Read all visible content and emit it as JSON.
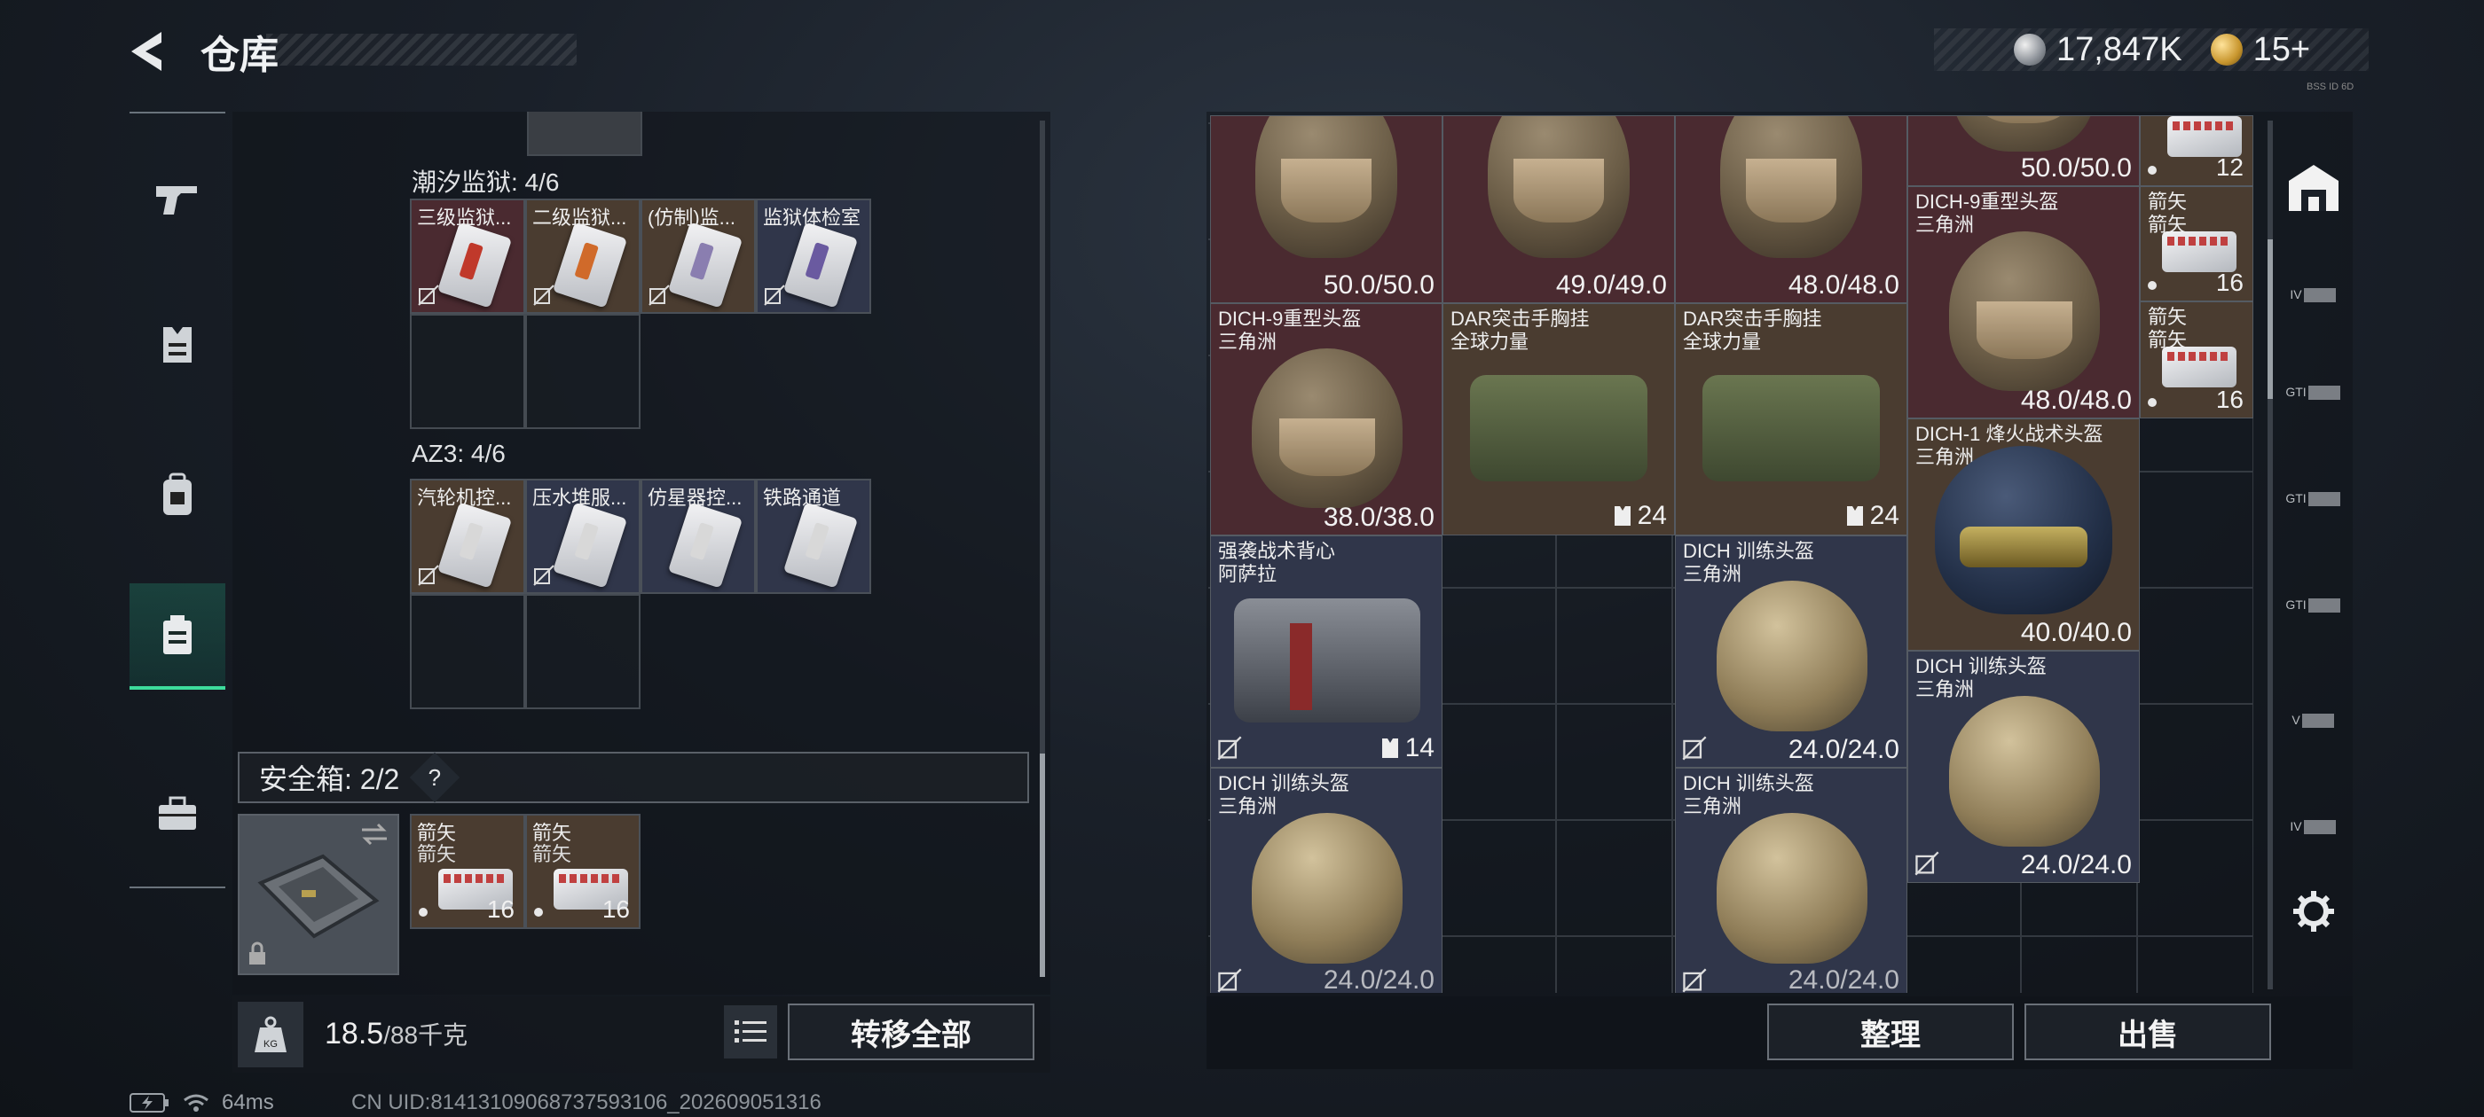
{
  "header": {
    "title": "仓库",
    "currency_silver": "17,847K",
    "currency_gold": "15+",
    "tiny_info": "BSS ID 6D"
  },
  "nav_left": [
    {
      "icon": "pistol-icon"
    },
    {
      "icon": "vest-icon"
    },
    {
      "icon": "backpack-icon"
    },
    {
      "icon": "storage-box-icon",
      "active": true
    },
    {
      "icon": "briefcase-icon"
    }
  ],
  "containers": [
    {
      "label": "潮汐监狱: 4/6",
      "items": [
        {
          "name": "三级监狱...",
          "color": "red",
          "kc": "#c0392b"
        },
        {
          "name": "二级监狱...",
          "color": "brown",
          "kc": "#d06a2a"
        },
        {
          "name": "(仿制)监...",
          "color": "brown",
          "kc": "#8a7eb0"
        },
        {
          "name": "监狱体检室",
          "color": "blue",
          "kc": "#6a5aa0"
        }
      ]
    },
    {
      "label": "AZ3: 4/6",
      "items": [
        {
          "name": "汽轮机控...",
          "color": "brown",
          "kc": "#d8d8d8"
        },
        {
          "name": "压水堆服...",
          "color": "blue",
          "kc": "#d8d8d8"
        },
        {
          "name": "仿星器控...",
          "color": "blue",
          "kc": "#d8d8d8"
        },
        {
          "name": "铁路通道",
          "color": "blue",
          "kc": "#d8d8d8"
        }
      ]
    }
  ],
  "safe_box": {
    "label": "安全箱: 2/2",
    "help": "?",
    "items": [
      {
        "name": "箭矢",
        "sub": "箭矢",
        "count": "16"
      },
      {
        "name": "箭矢",
        "sub": "箭矢",
        "count": "16"
      }
    ]
  },
  "weight": {
    "current": "18.5",
    "max": "/88千克"
  },
  "buttons": {
    "transfer_all": "转移全部",
    "sort": "整理",
    "sell": "出售"
  },
  "right_items": {
    "heavy1": {
      "dur": "50.0/50.0"
    },
    "heavy2": {
      "dur": "49.0/49.0"
    },
    "heavy3": {
      "dur": "48.0/48.0"
    },
    "top_partial": {
      "dur": "50.0/50.0"
    },
    "arrow_top": {
      "count": "12"
    },
    "heavy4": {
      "name": "DICH-9重型头盔",
      "sub": "三角洲",
      "dur": "48.0/48.0"
    },
    "arrow1": {
      "name": "箭矢",
      "sub": "箭矢",
      "count": "16"
    },
    "arrow2": {
      "name": "箭矢",
      "sub": "箭矢",
      "count": "16"
    },
    "heavy5": {
      "name": "DICH-9重型头盔",
      "sub": "三角洲",
      "dur": "38.0/38.0"
    },
    "dar1": {
      "name": "DAR突击手胸挂",
      "sub": "全球力量",
      "cap": "24"
    },
    "dar2": {
      "name": "DAR突击手胸挂",
      "sub": "全球力量",
      "cap": "24"
    },
    "night": {
      "name": "DICH-1 烽火战术头盔",
      "sub": "三角洲",
      "dur": "40.0/40.0"
    },
    "vest": {
      "name": "强袭战术背心",
      "sub": "阿萨拉",
      "cap": "14"
    },
    "train1": {
      "name": "DICH 训练头盔",
      "sub": "三角洲",
      "dur": "24.0/24.0"
    },
    "train2": {
      "name": "DICH 训练头盔",
      "sub": "三角洲",
      "dur": "24.0/24.0"
    },
    "train3": {
      "name": "DICH 训练头盔",
      "sub": "三角洲",
      "dur": "24.0/24.0"
    },
    "train4": {
      "name": "DICH 训练头盔",
      "sub": "三角洲",
      "dur": "24.0/24.0"
    }
  },
  "right_toolbar": [
    {
      "icon": "home-base-icon"
    },
    {
      "label": "IV"
    },
    {
      "label": "GTI"
    },
    {
      "label": "GTI"
    },
    {
      "label": "GTI"
    },
    {
      "label": "V"
    },
    {
      "label": "IV"
    },
    {
      "icon": "settings-gear-icon"
    }
  ],
  "status": {
    "ping": "64ms",
    "uid": "CN UID:81413109068737593106_202609051316"
  }
}
